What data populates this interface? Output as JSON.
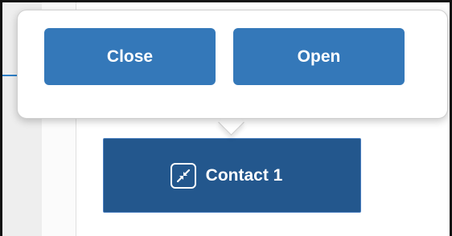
{
  "popover": {
    "close_label": "Close",
    "open_label": "Open"
  },
  "contact_button": {
    "label": "Contact 1",
    "icon": "collapse-arrows-icon"
  },
  "colors": {
    "popover_button_bg": "#3478b9",
    "contact_button_bg": "#23578d",
    "accent": "#2f80c8"
  }
}
